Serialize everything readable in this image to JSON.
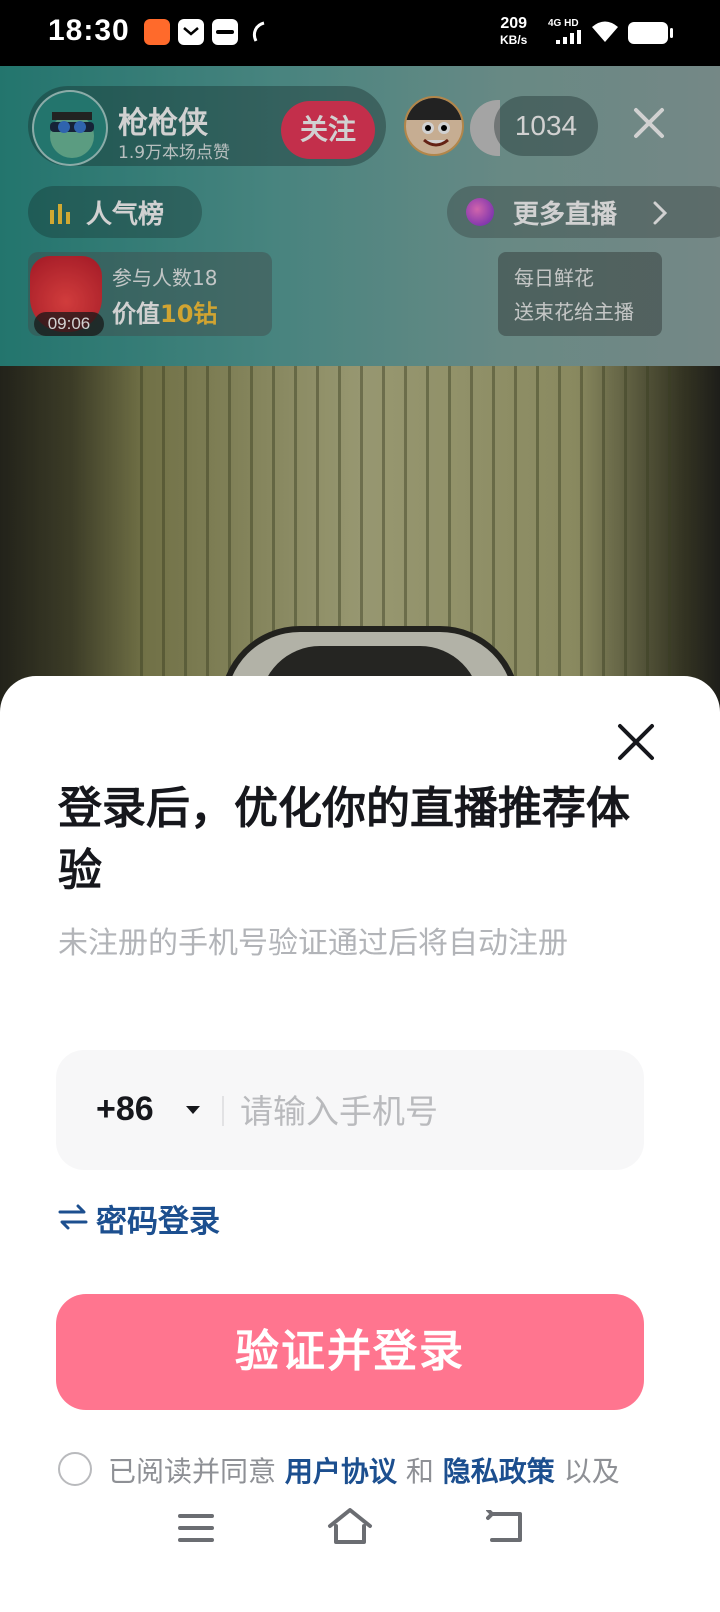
{
  "status_bar": {
    "time": "18:30",
    "net_speed_value": "209",
    "net_speed_unit": "KB/s",
    "network_type": "4G HD",
    "app_icons": [
      "orange-app-icon",
      "mail-icon",
      "vivo-icon",
      "call-icon"
    ]
  },
  "live": {
    "host_name": "枪枪侠",
    "host_likes": "1.9万本场点赞",
    "follow_label": "关注",
    "viewer_count": "1034",
    "rank_label": "人气榜",
    "more_live_label": "更多直播",
    "gift": {
      "participants": "参与人数18",
      "value_prefix": "价值",
      "value_amount": "10钻",
      "timer": "09:06"
    },
    "flower": {
      "line1": "每日鲜花",
      "line2": "送束花给主播"
    }
  },
  "login": {
    "title": "登录后，优化你的直播推荐体验",
    "subtitle": "未注册的手机号验证通过后将自动注册",
    "country_code": "+86",
    "phone_placeholder": "请输入手机号",
    "phone_value": "",
    "password_login": "密码登录",
    "submit_label": "验证并登录",
    "agreement": {
      "prefix": "已阅读并同意",
      "user_agreement": "用户协议",
      "and": "和",
      "privacy_policy": "隐私政策",
      "suffix": "以及"
    }
  },
  "colors": {
    "accent_pink": "#ff758f",
    "follow_red": "#ee3a5c",
    "link_blue": "#1c4f8f",
    "gold": "#ffc93c"
  }
}
